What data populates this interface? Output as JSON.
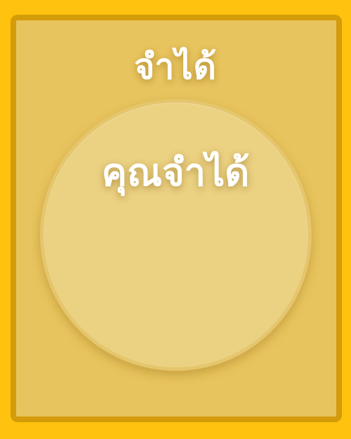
{
  "title": "จำได้",
  "circle": {
    "text": "คุณจำได้"
  },
  "colors": {
    "background": "#ffc20e",
    "frame_border": "#d49b0a",
    "panel": "#e8c45e",
    "circle": "#ebd182",
    "text": "#ffffff"
  }
}
